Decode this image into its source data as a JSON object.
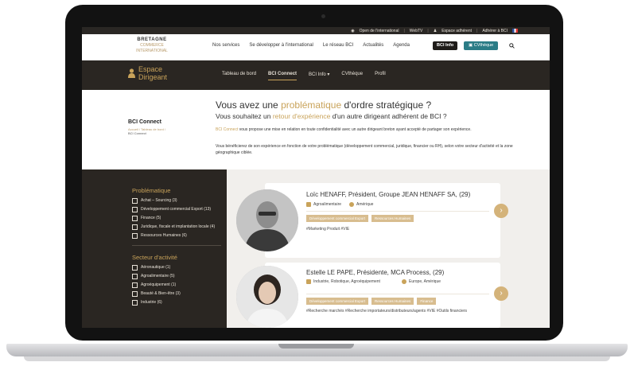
{
  "topbar": {
    "open_international": "Open de l'international",
    "webtv": "WebTV",
    "espace_adherent": "Espace adhérent",
    "adherer": "Adhérer à BCI",
    "flag": "fr-flag-icon"
  },
  "header": {
    "logo_line1": "BRETAGNE",
    "logo_line2": "COMMERCE",
    "logo_line3": "INTERNATIONAL",
    "nav": [
      "Nos services",
      "Se développer à l'international",
      "Le réseau BCI",
      "Actualités",
      "Agenda"
    ],
    "bci_info_button": "BCI Info",
    "cvtheque_button": "CVthèque",
    "search_icon": "search-icon"
  },
  "section_nav": {
    "title_line1": "Espace",
    "title_line2": "Dirigeant",
    "items": [
      "Tableau de bord",
      "BCI Connect",
      "BCI Info ▾",
      "CVthèque",
      "Profil"
    ],
    "active": "BCI Connect"
  },
  "intro": {
    "page_title": "BCI Connect",
    "breadcrumb": [
      "Accueil / Tableau de bord /",
      "BCI Connect"
    ],
    "h1_before": "Vous avez une ",
    "h1_highlight": "problématique",
    "h1_after": " d'ordre stratégique ?",
    "h2_before": "Vous souhaitez un ",
    "h2_highlight": "retour d'expérience",
    "h2_after": " d'un autre dirigeant adhérent de BCI ?",
    "p1_link": "BCI Connect",
    "p1_text": " vous propose une mise en relation en toute confidentialité avec un autre dirigeant breton ayant accepté de partager son expérience.",
    "p2_text": "Vous bénéficierez de son expérience en fonction de votre problématique (développement commercial, juridique, financier ou RH), selon votre secteur d'activité et la zone géographique ciblée."
  },
  "filters": {
    "problematique_title": "Problématique",
    "problematique_items": [
      "Achat – Sourcing (3)",
      "Développement commercial Export (13)",
      "Finance (5)",
      "Juridique, fiscale et implantation locale (4)",
      "Ressources Humaines (6)"
    ],
    "secteur_title": "Secteur d'activité",
    "secteur_items": [
      "Aéronautique (1)",
      "Agroalimentaire (5)",
      "Agroéquipement (1)",
      "Beauté & Bien-être (3)",
      "Industrie (6)"
    ]
  },
  "cards": [
    {
      "name": "Loïc HENAFF, Président, Groupe JEAN HENAFF SA, (29)",
      "sector": "Agroalimentaire",
      "zone": "Amérique",
      "tags": [
        "Développement commercial Export",
        "Ressources Humaines"
      ],
      "hashtags": "#Marketing Produit  #VIE"
    },
    {
      "name": "Estelle LE PAPE, Présidente, MCA Process, (29)",
      "sector": "Industrie, Robotique, Agroéquipement",
      "zone": "Europe, Amérique",
      "tags": [
        "Développement commercial Export",
        "Ressources Humaines",
        "Finance"
      ],
      "hashtags": "#Recherche marchés  #Recherche importateurs/distributeurs/agents  #VIE  #Outils financiers"
    }
  ],
  "colors": {
    "accent_gold": "#c9a35a",
    "dark_bg": "#2a2622",
    "teal_button": "#2b7c86"
  }
}
